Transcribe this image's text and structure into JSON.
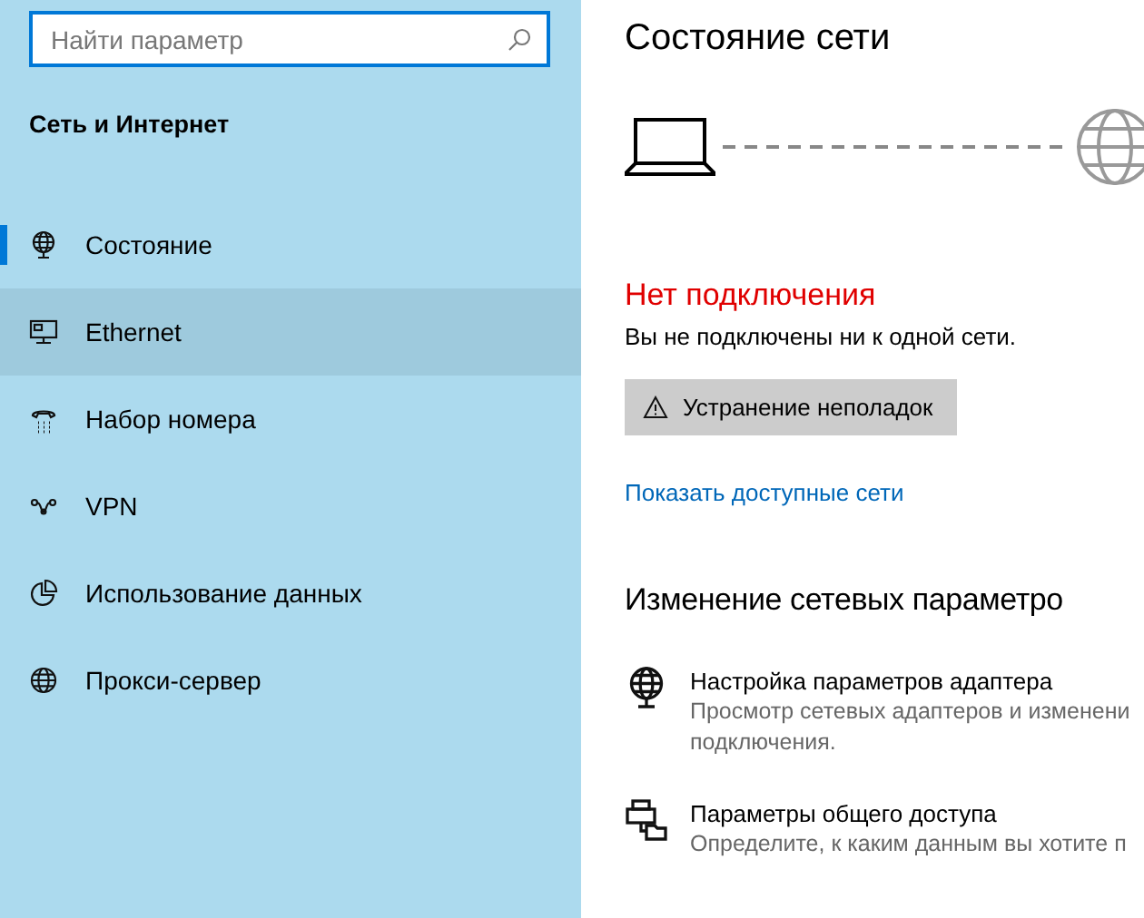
{
  "search": {
    "placeholder": "Найти параметр"
  },
  "sidebar": {
    "title": "Сеть и Интернет",
    "items": [
      {
        "label": "Состояние",
        "kind": "status",
        "selected": true,
        "hovered": false
      },
      {
        "label": "Ethernet",
        "kind": "ethernet",
        "selected": false,
        "hovered": true
      },
      {
        "label": "Набор номера",
        "kind": "dialup",
        "selected": false,
        "hovered": false
      },
      {
        "label": "VPN",
        "kind": "vpn",
        "selected": false,
        "hovered": false
      },
      {
        "label": "Использование данных",
        "kind": "data",
        "selected": false,
        "hovered": false
      },
      {
        "label": "Прокси-сервер",
        "kind": "globe",
        "selected": false,
        "hovered": false
      }
    ]
  },
  "main": {
    "title": "Состояние сети",
    "connected": false,
    "status_title": "Нет подключения",
    "status_text": "Вы не подключены ни к одной сети.",
    "troubleshoot_button": "Устранение неполадок",
    "link": "Показать доступные сети",
    "section_title": "Изменение сетевых параметро",
    "settings": [
      {
        "kind": "adapter",
        "title": "Настройка параметров адаптера",
        "description": [
          "Просмотр сетевых адаптеров и изменени",
          "подключения."
        ]
      },
      {
        "kind": "sharing",
        "title": "Параметры общего доступа",
        "description": [
          "Определите, к каким данным вы хотите п"
        ]
      }
    ]
  }
}
